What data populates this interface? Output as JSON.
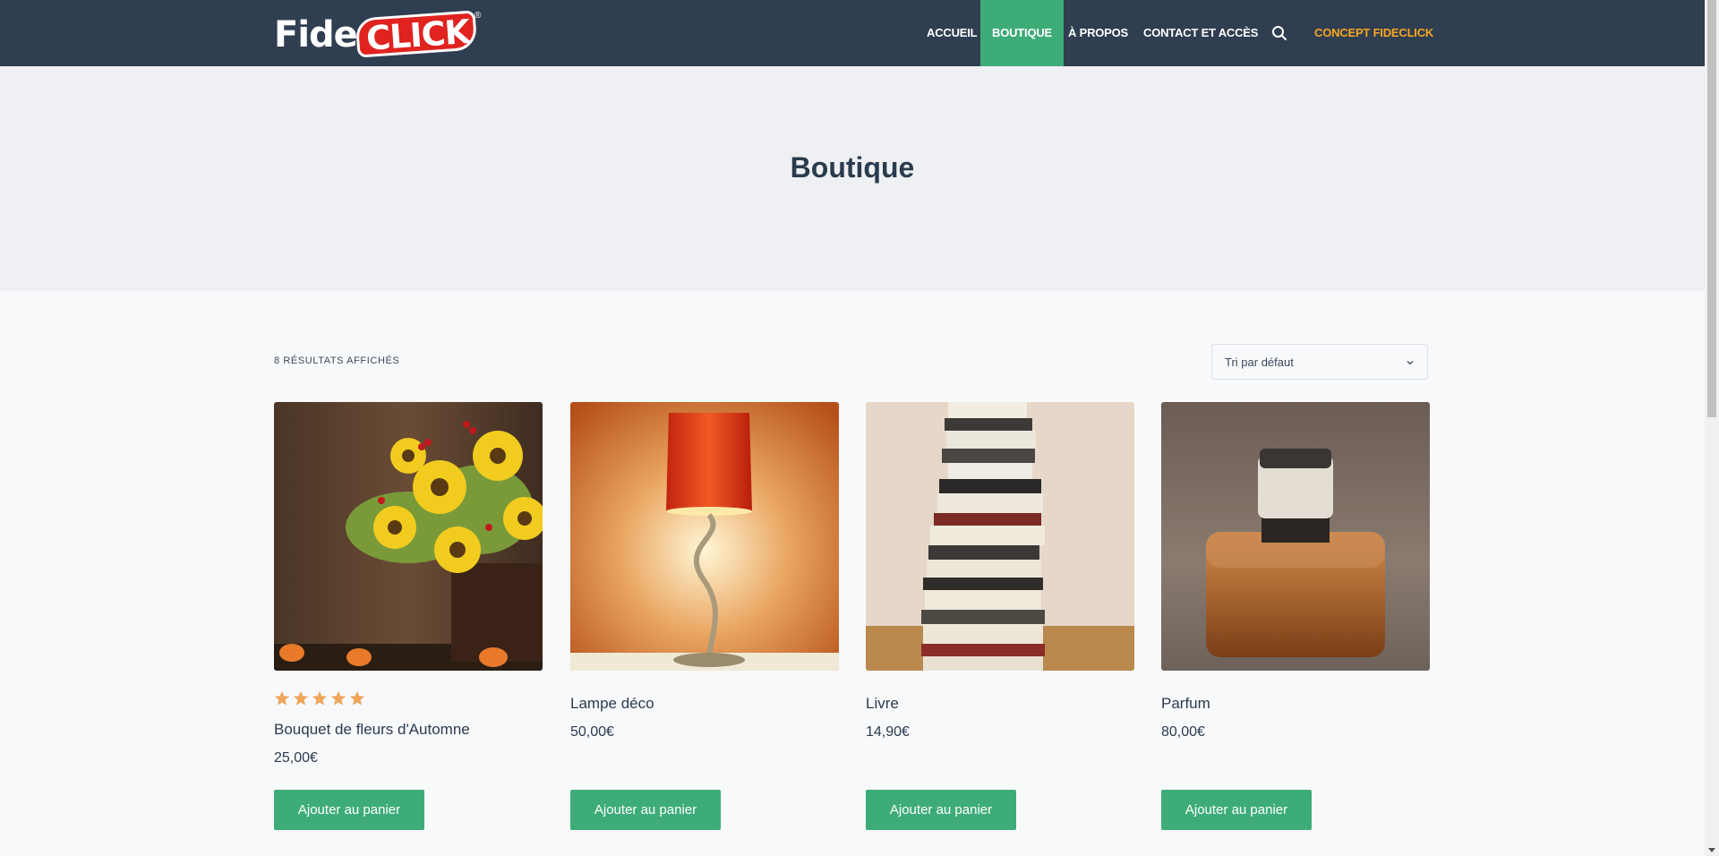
{
  "brand": {
    "logo_part1": "Fide",
    "logo_part2": "CLICK",
    "registered": "®"
  },
  "nav": {
    "items": [
      {
        "label": "ACCUEIL"
      },
      {
        "label": "BOUTIQUE",
        "active": true
      },
      {
        "label": "À PROPOS"
      },
      {
        "label": "CONTACT ET ACCÈS"
      }
    ],
    "concept_label": "CONCEPT FIDECLICK",
    "search_icon": "search-icon"
  },
  "page": {
    "title": "Boutique"
  },
  "shop": {
    "result_count": "8 RÉSULTATS AFFICHÉS",
    "sort_selected": "Tri par défaut"
  },
  "products": [
    {
      "name": "Bouquet de fleurs d'Automne",
      "price": "25,00€",
      "rating": 5,
      "button": "Ajouter au panier"
    },
    {
      "name": "Lampe déco",
      "price": "50,00€",
      "button": "Ajouter au panier"
    },
    {
      "name": "Livre",
      "price": "14,90€",
      "button": "Ajouter au panier"
    },
    {
      "name": "Parfum",
      "price": "80,00€",
      "button": "Ajouter au panier"
    }
  ],
  "colors": {
    "header_bg": "#2f3e50",
    "accent_green": "#3eac78",
    "concept_orange": "#f6a623",
    "star_orange": "#f0a55a"
  }
}
